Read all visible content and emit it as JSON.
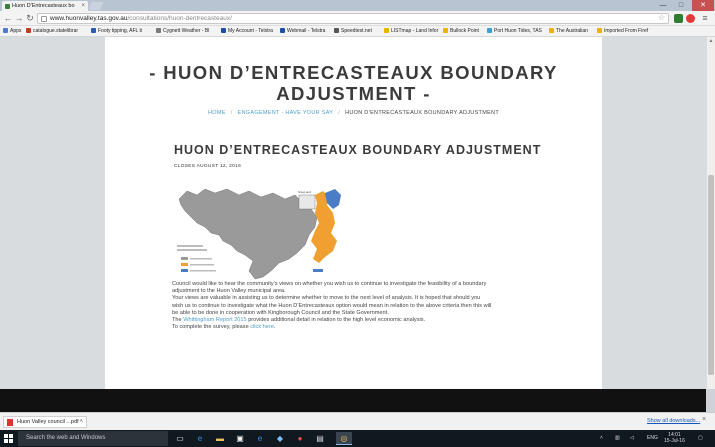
{
  "browser": {
    "tab_title": "Huon D'Entrecasteaux bo",
    "tab_close": "×",
    "window_controls": {
      "minimize": "—",
      "maximize": "□",
      "close": "✕"
    },
    "url_host": "www.huonvalley.tas.gov.au",
    "url_path": "/consultations/huon-dentrecasteaux/",
    "nav": {
      "back": "←",
      "forward": "→",
      "reload": "↻"
    },
    "star": "☆",
    "menu": "≡"
  },
  "bookmarks": [
    {
      "label": "Apps",
      "color": "#4a7bd0"
    },
    {
      "label": "catalogue.statelibrar",
      "color": "#c23b22"
    },
    {
      "label": "Footy tipping, AFL ti",
      "color": "#2a5db0"
    },
    {
      "label": "Cygnett Weather - Bl",
      "color": "#7a7a7a"
    },
    {
      "label": "My Account - Telstra",
      "color": "#1e4ea8"
    },
    {
      "label": "Webmail - Telstra",
      "color": "#1e4ea8"
    },
    {
      "label": "Speedtest.net",
      "color": "#555555"
    },
    {
      "label": "LISTmap - Land Infor",
      "color": "#e8b400"
    },
    {
      "label": "Bullock Point",
      "color": "#e8b400"
    },
    {
      "label": "Port Huon Tides, TAS",
      "color": "#3aa0d0"
    },
    {
      "label": "The Australian",
      "color": "#e8b400"
    },
    {
      "label": "Imported From Firef",
      "color": "#e8b400"
    }
  ],
  "page": {
    "heading": "- HUON D’ENTRECASTEAUX BOUNDARY ADJUSTMENT -",
    "breadcrumb": {
      "home": "HOME",
      "engagement": "ENGAGEMENT - HAVE YOUR SAY",
      "current": "HUON D’ENTRECASTEAUX BOUNDARY ADJUSTMENT",
      "separator": "/"
    },
    "article_title": "HUON D’ENTRECASTEAUX BOUNDARY ADJUSTMENT",
    "closes": "CLOSES AUGUST 12, 2016",
    "map": {
      "colors": {
        "huon_valley": "#9a9a9a",
        "proposed": "#f0a030",
        "remaining": "#4a7cc8"
      },
      "label": "Snug and"
    },
    "paragraphs": [
      "Council would like to hear the community’s views on whether you wish us to continue to investigate the feasibility of a boundary",
      "adjustment to the Huon Valley municipal area.",
      "Your views are valuable in assisting us to determine whether to move to the next level of analysis.  It is hoped that should you",
      "wish us to continue to investigate what the Huon D’Entrecasteaux option would mean in relation to the above criteria then this will",
      "be able to be  done in cooperation with Kingborough Council and the State Government."
    ],
    "report_pre": "The ",
    "report_link": "Whittingham Report 2015",
    "report_post": " provides additional detail in relation to the high level economic analysis.",
    "survey_pre": "To complete the survey, please ",
    "survey_link": "click here",
    "survey_post": "."
  },
  "downloads": {
    "item": "Huon Valley council ...pdf",
    "chevron": "˄",
    "show_all": "Show all downloads...",
    "close": "×"
  },
  "taskbar": {
    "search_placeholder": "Search the web and Windows",
    "lang": "ENG",
    "time": "14:01",
    "date": "15-Jul-16"
  }
}
